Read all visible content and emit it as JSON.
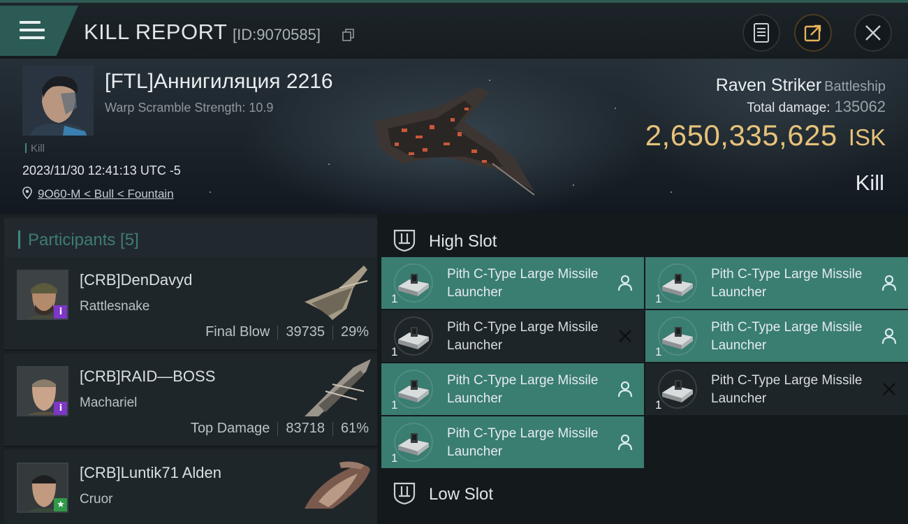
{
  "header": {
    "title": "KILL REPORT",
    "report_id": "[ID:9070585]"
  },
  "victim": {
    "name": "[FTL]Аннигиляция 2216",
    "warp_scramble": "Warp Scramble Strength: 10.9",
    "tag": "Kill",
    "datetime": "2023/11/30 12:41:13 UTC -5",
    "location": "9O60-M < Bull < Fountain",
    "ship_name": "Raven Striker",
    "ship_class": "Battleship",
    "total_damage_label": "Total damage:",
    "total_damage": "135062",
    "isk_value": "2,650,335,625",
    "isk_unit": "ISK",
    "result": "Kill"
  },
  "participants": {
    "title": "Participants [5]",
    "rows": [
      {
        "name": "[CRB]DenDavyd",
        "ship": "Rattlesnake",
        "role": "Final Blow",
        "damage": "39735",
        "percent": "29%",
        "badge": "i",
        "badge_color": "#7d36c8"
      },
      {
        "name": "[CRB]RAID—BOSS",
        "ship": "Machariel",
        "role": "Top Damage",
        "damage": "83718",
        "percent": "61%",
        "badge": "i",
        "badge_color": "#7d36c8"
      },
      {
        "name": "[CRB]Luntik71 Alden",
        "ship": "Cruor",
        "badge": "★",
        "badge_color": "#2f9a47"
      }
    ]
  },
  "fitting": {
    "high_slot": {
      "title": "High Slot",
      "modules": [
        {
          "name": "Pith C-Type Large Missile Launcher",
          "qty": "1",
          "state": "dropped",
          "icon": "person-icon"
        },
        {
          "name": "Pith C-Type Large Missile Launcher",
          "qty": "1",
          "state": "dropped",
          "icon": "person-icon"
        },
        {
          "name": "Pith C-Type Large Missile Launcher",
          "qty": "1",
          "state": "destroyed",
          "icon": "cross-icon"
        },
        {
          "name": "Pith C-Type Large Missile Launcher",
          "qty": "1",
          "state": "dropped",
          "icon": "person-icon"
        },
        {
          "name": "Pith C-Type Large Missile Launcher",
          "qty": "1",
          "state": "dropped",
          "icon": "person-icon"
        },
        {
          "name": "Pith C-Type Large Missile Launcher",
          "qty": "1",
          "state": "destroyed",
          "icon": "cross-icon"
        },
        {
          "name": "Pith C-Type Large Missile Launcher",
          "qty": "1",
          "state": "dropped",
          "icon": "person-icon"
        }
      ]
    },
    "low_slot": {
      "title": "Low Slot"
    }
  },
  "colors": {
    "accent_teal": "#3a7d71",
    "isk_gold": "#e6c27a",
    "dropped_bg": "#3a7d71",
    "destroyed_bg": "#1e2528"
  }
}
